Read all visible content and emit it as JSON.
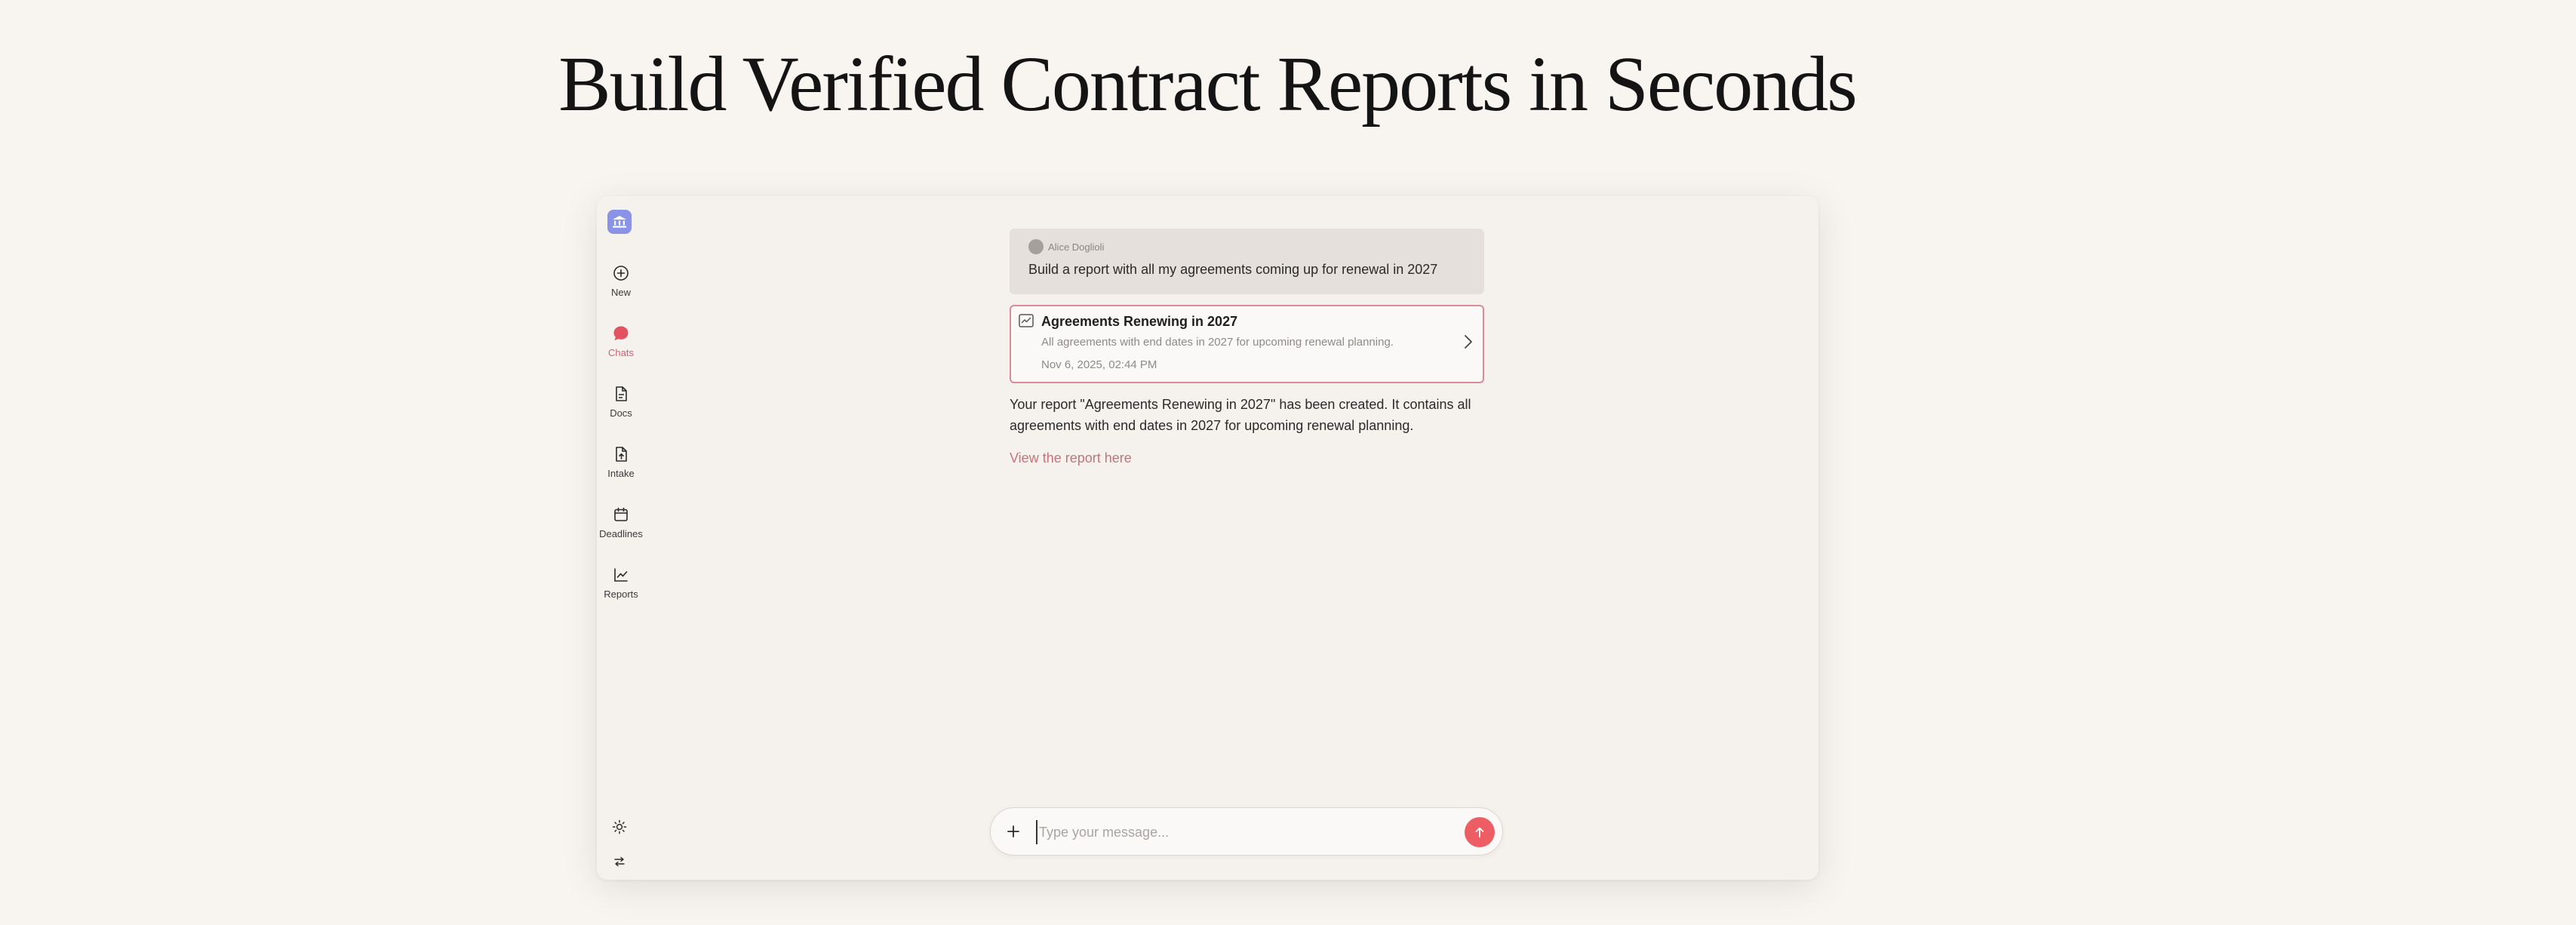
{
  "hero": {
    "title": "Build Verified Contract Reports in Seconds"
  },
  "sidebar": {
    "items": [
      {
        "label": "New",
        "icon": "plus-circle-icon"
      },
      {
        "label": "Chats",
        "icon": "chat-bubble-icon",
        "active": true
      },
      {
        "label": "Docs",
        "icon": "document-icon"
      },
      {
        "label": "Intake",
        "icon": "file-upload-icon"
      },
      {
        "label": "Deadlines",
        "icon": "calendar-icon"
      },
      {
        "label": "Reports",
        "icon": "line-chart-icon"
      }
    ],
    "utilities": [
      "sun-icon",
      "swap-arrows-icon"
    ]
  },
  "chat": {
    "user": {
      "name": "Alice Doglioli",
      "message": "Build a report with all my agreements coming up for renewal in 2027"
    },
    "report_card": {
      "title": "Agreements Renewing in 2027",
      "description": "All agreements with end dates in 2027 for upcoming renewal planning.",
      "date": "Nov 6, 2025, 02:44 PM"
    },
    "assistant_message": "Your report \"Agreements Renewing in 2027\" has been created. It contains all agreements with end dates in 2027 for upcoming renewal planning.",
    "link_label": "View the report here"
  },
  "composer": {
    "placeholder": "Type your message..."
  },
  "colors": {
    "accent": "#ec5e63",
    "active_nav": "#d1606d",
    "logo": "#8b93e6",
    "card_border": "#d88c95",
    "link": "#c7727b"
  }
}
